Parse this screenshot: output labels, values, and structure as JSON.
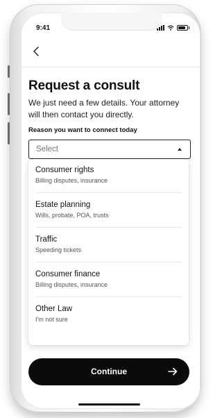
{
  "status": {
    "time": "9:41",
    "icons": [
      "signal-icon",
      "wifi-icon",
      "battery-icon"
    ]
  },
  "nav": {
    "back_icon": "chevron-left-icon"
  },
  "header": {
    "title": "Request a consult",
    "subtitle": "We just need a few details. Your attorney will then contact you directly."
  },
  "form": {
    "reason_label": "Reason you want to connect today",
    "select_value": "Select",
    "options": [
      {
        "title": "Consumer rights",
        "subtitle": "Billing disputes, insurance"
      },
      {
        "title": "Estate planning",
        "subtitle": "Wills, probate, POA, trusts"
      },
      {
        "title": "Traffic",
        "subtitle": "Speeding tickets"
      },
      {
        "title": "Consumer finance",
        "subtitle": "Billing disputes, insurance"
      },
      {
        "title": "Other Law",
        "subtitle": "I'm not sure"
      }
    ]
  },
  "footer": {
    "continue_label": "Continue",
    "continue_icon": "arrow-right-icon"
  },
  "colors": {
    "primary": "#0b0b0b",
    "text": "#111111",
    "muted": "#555555"
  }
}
